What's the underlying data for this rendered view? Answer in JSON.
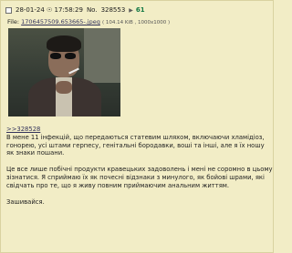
{
  "post": {
    "date": "28-01-24 ☉ 17:58:29",
    "no_label": "No.",
    "number": "328553",
    "arrow": "▶",
    "replies": "61",
    "file_label": "File:",
    "file_name": "1706457509.653665-.jpeg",
    "file_meta": "( 104.14 KiB , 1000x1000 )",
    "reply_link": ">>328528",
    "paragraphs": [
      "В мене 11 інфекцій, що передаються статевим шляхом, включаючи хламідіоз, гонорею, усі штами герпесу, генітальні бородавки, воші та інші, але я їх ношу як знаки пошани.",
      "Це все лише побічні продукти кравецьких задоволень і мені не соромно в цьому зізнатися. Я сприймаю їх як почесні відзнаки з минулого, як бойові шрами, які свідчать про те, що я живу повним приймаючим анальним життям.",
      "Зашивайся."
    ]
  }
}
